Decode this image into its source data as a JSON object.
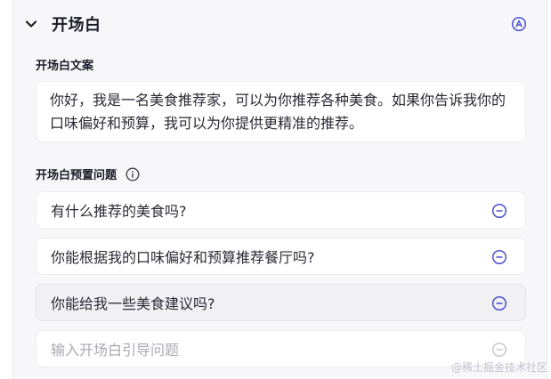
{
  "section": {
    "title": "开场白",
    "collapse_icon": "chevron-down-icon",
    "ai_icon": "ai-circle-icon"
  },
  "opening_copy": {
    "label": "开场白文案",
    "text": "你好，我是一名美食推荐家，可以为你推荐各种美食。如果你告诉我你的口味偏好和预算，我可以为你提供更精准的推荐。"
  },
  "preset_questions": {
    "label": "开场白预置问题",
    "info_icon": "info-icon",
    "items": [
      {
        "text": "有什么推荐的美食吗?"
      },
      {
        "text": "你能根据我的口味偏好和预算推荐餐厅吗?"
      },
      {
        "text": "你能给我一些美食建议吗?"
      }
    ],
    "input_placeholder": "输入开场白引导问题"
  },
  "watermark": "@稀土掘金技术社区",
  "colors": {
    "accent": "#4b4fcf",
    "disabled_icon": "#c8c8d0"
  }
}
